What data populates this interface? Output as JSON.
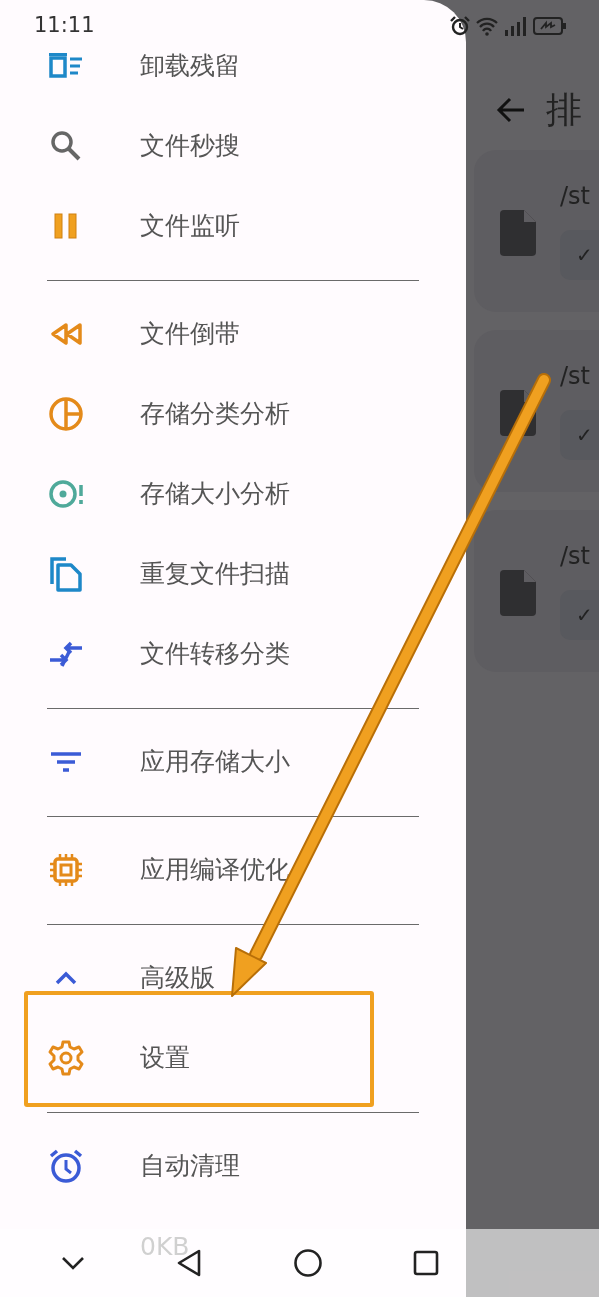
{
  "status_bar": {
    "time": "11:11"
  },
  "drawer": {
    "items": [
      {
        "kind": "item",
        "label": "卸载残留"
      },
      {
        "kind": "item",
        "label": "文件秒搜"
      },
      {
        "kind": "item",
        "label": "文件监听"
      },
      {
        "kind": "divider"
      },
      {
        "kind": "item",
        "label": "文件倒带"
      },
      {
        "kind": "item",
        "label": "存储分类分析"
      },
      {
        "kind": "item",
        "label": "存储大小分析"
      },
      {
        "kind": "item",
        "label": "重复文件扫描"
      },
      {
        "kind": "item",
        "label": "文件转移分类"
      },
      {
        "kind": "divider"
      },
      {
        "kind": "item",
        "label": "应用存储大小"
      },
      {
        "kind": "divider"
      },
      {
        "kind": "item",
        "label": "应用编译优化"
      },
      {
        "kind": "divider"
      },
      {
        "kind": "section",
        "label": "高级版",
        "expanded": true
      },
      {
        "kind": "item",
        "label": "设置",
        "highlighted": true
      },
      {
        "kind": "divider"
      },
      {
        "kind": "item",
        "label": "自动清理"
      }
    ],
    "footer_text": "0KB"
  },
  "app": {
    "title": "排",
    "files": [
      {
        "path": "/st",
        "chip": "✓"
      },
      {
        "path": "/st",
        "chip": "✓"
      },
      {
        "path": "/st",
        "chip": "✓"
      }
    ]
  }
}
